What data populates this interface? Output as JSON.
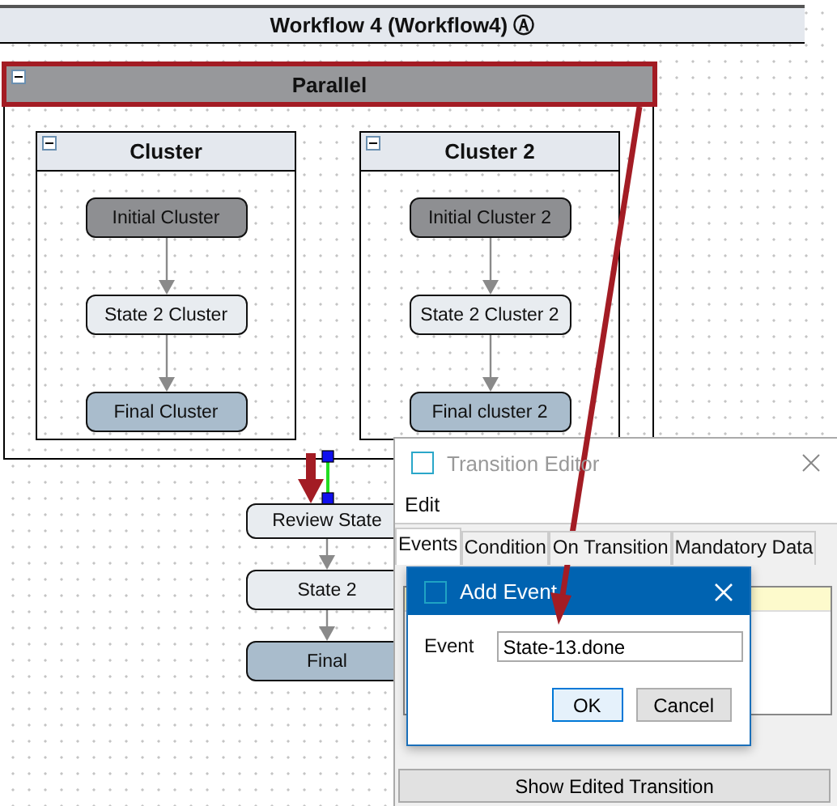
{
  "window": {
    "title": "Workflow 4 (Workflow4) Ⓐ"
  },
  "parallel": {
    "title": "Parallel",
    "highlighted": true,
    "clusters": [
      {
        "title": "Cluster",
        "states": [
          {
            "label": "Initial Cluster",
            "kind": "initial"
          },
          {
            "label": "State 2 Cluster",
            "kind": "normal"
          },
          {
            "label": "Final Cluster",
            "kind": "final"
          }
        ]
      },
      {
        "title": "Cluster 2",
        "states": [
          {
            "label": "Initial Cluster 2",
            "kind": "initial"
          },
          {
            "label": "State 2 Cluster 2",
            "kind": "normal"
          },
          {
            "label": "Final cluster 2",
            "kind": "final"
          }
        ]
      }
    ]
  },
  "states": [
    {
      "label": "Review State",
      "kind": "normal"
    },
    {
      "label": "State 2",
      "kind": "normal"
    },
    {
      "label": "Final",
      "kind": "final"
    }
  ],
  "transition_editor": {
    "title": "Transition Editor",
    "menu": [
      "Edit"
    ],
    "tabs": [
      {
        "label": "Events",
        "selected": true
      },
      {
        "label": "Condition",
        "selected": false
      },
      {
        "label": "On Transition",
        "selected": false
      },
      {
        "label": "Mandatory Data",
        "selected": false
      }
    ],
    "footer_button": "Show Edited Transition"
  },
  "add_event": {
    "title": "Add Event",
    "field_label": "Event",
    "value": "State-13.done",
    "buttons": [
      {
        "label": "OK",
        "default": true
      },
      {
        "label": "Cancel",
        "default": false
      }
    ]
  }
}
